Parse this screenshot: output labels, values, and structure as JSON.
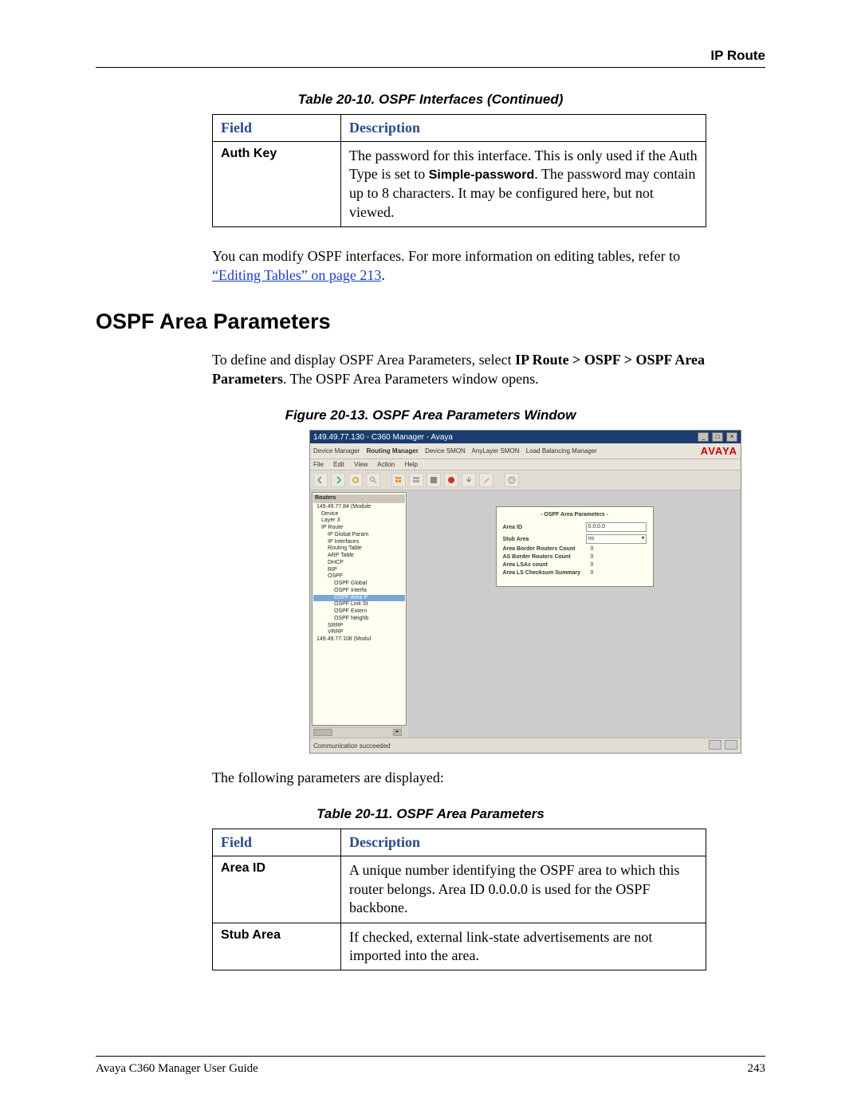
{
  "header": {
    "section": "IP Route"
  },
  "table2010": {
    "caption": "Table 20-10.  OSPF Interfaces (Continued)",
    "head_field": "Field",
    "head_desc": "Description",
    "row_field": "Auth Key",
    "row_desc_a": "The password for this interface. This is only used if the Auth Type is set to ",
    "row_desc_bold": "Simple-password",
    "row_desc_b": ". The password may contain up to 8 characters. It may be configured here, but not viewed."
  },
  "para1_a": "You can modify OSPF interfaces. For more information on editing tables, refer to ",
  "para1_link": "“Editing Tables” on page 213",
  "para1_b": ".",
  "section_title": "OSPF Area Parameters",
  "para2_a": "To define and display OSPF Area Parameters, select ",
  "para2_bold": "IP Route > OSPF > OSPF Area Parameters",
  "para2_b": ". The OSPF Area Parameters window opens.",
  "figure_caption": "Figure 20-13.  OSPF Area Parameters Window",
  "para3": "The following parameters are displayed:",
  "table2011": {
    "caption": "Table 20-11.  OSPF Area Parameters",
    "head_field": "Field",
    "head_desc": "Description",
    "rows": [
      {
        "field": "Area ID",
        "desc": "A unique number identifying the OSPF area to which this router belongs. Area ID 0.0.0.0 is used for the OSPF backbone."
      },
      {
        "field": "Stub Area",
        "desc": "If checked, external link-state advertisements are not imported into the area."
      }
    ]
  },
  "app": {
    "title": "149.49.77.130 - C360 Manager - Avaya",
    "logo": "AVAYA",
    "tabs": [
      "Device Manager",
      "Routing Manager",
      "Device SMON",
      "AnyLayer SMON",
      "Load Balancing Manager"
    ],
    "menu": [
      "File",
      "Edit",
      "View",
      "Action",
      "Help"
    ],
    "tree": [
      {
        "t": "Routers",
        "cls": "hdr"
      },
      {
        "t": "149.49.77.84 (Module",
        "cls": "item"
      },
      {
        "t": "Device",
        "cls": "item l1"
      },
      {
        "t": "Layer 3",
        "cls": "item l1"
      },
      {
        "t": "IP Route",
        "cls": "item l1"
      },
      {
        "t": "IP Global Param",
        "cls": "item l2"
      },
      {
        "t": "IP Interfaces",
        "cls": "item l2"
      },
      {
        "t": "Routing Table",
        "cls": "item l2"
      },
      {
        "t": "ARP Table",
        "cls": "item l2"
      },
      {
        "t": "DHCP",
        "cls": "item l2"
      },
      {
        "t": "RIP",
        "cls": "item l2"
      },
      {
        "t": "OSPF",
        "cls": "item l2"
      },
      {
        "t": "OSPF Global",
        "cls": "item l3"
      },
      {
        "t": "OSPF Interfa",
        "cls": "item l3"
      },
      {
        "t": "OSPF Area P",
        "cls": "item l3 sel"
      },
      {
        "t": "OSPF Link St",
        "cls": "item l3"
      },
      {
        "t": "OSPF Extern",
        "cls": "item l3"
      },
      {
        "t": "OSPF Neighb",
        "cls": "item l3"
      },
      {
        "t": "SRRP",
        "cls": "item l2"
      },
      {
        "t": "VRRP",
        "cls": "item l2"
      },
      {
        "t": "149.49.77.108 (Modul",
        "cls": "item"
      }
    ],
    "panel": {
      "title": "- OSPF Area Parameters -",
      "rows": [
        {
          "label": "Area ID",
          "value": "0.0.0.0",
          "kind": "input"
        },
        {
          "label": "Stub Area",
          "value": "no",
          "kind": "dd"
        },
        {
          "label": "Area Border Routers Count",
          "value": "0",
          "kind": "text"
        },
        {
          "label": "AS Border Routers Count",
          "value": "0",
          "kind": "text"
        },
        {
          "label": "Area LSAs count",
          "value": "0",
          "kind": "text"
        },
        {
          "label": "Area LS Checksum Summary",
          "value": "0",
          "kind": "text"
        }
      ]
    },
    "status": "Communication succeeded"
  },
  "footer": {
    "left": "Avaya C360 Manager User Guide",
    "right": "243"
  }
}
